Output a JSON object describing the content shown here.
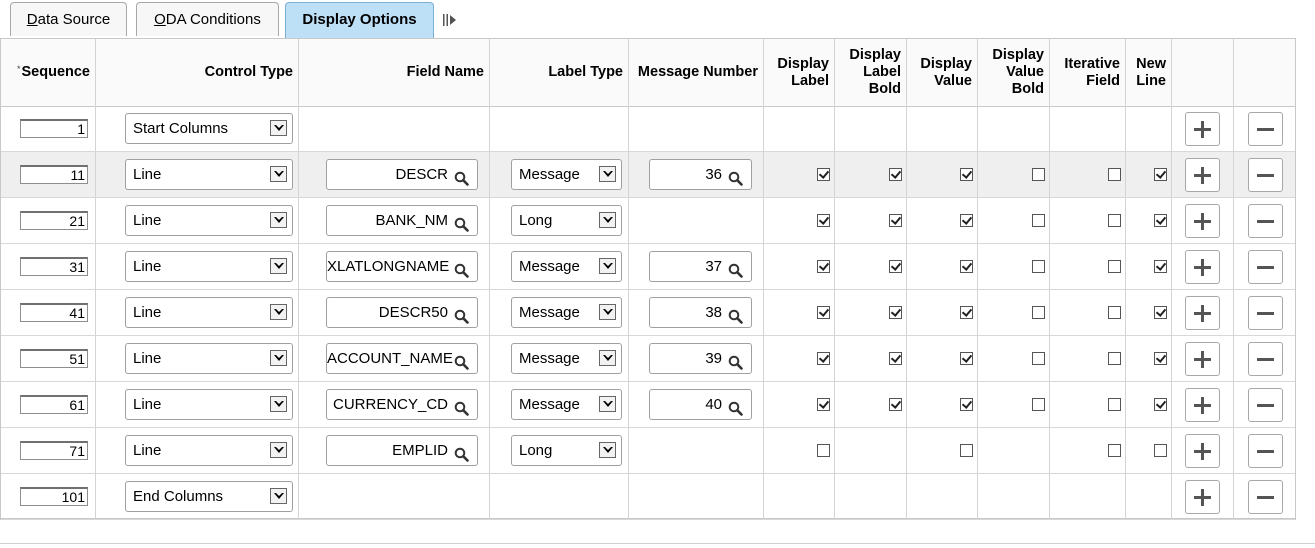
{
  "tabs": [
    {
      "label": "Data Source",
      "active": false
    },
    {
      "label": "ODA Conditions",
      "active": false
    },
    {
      "label": "Display Options",
      "active": true
    }
  ],
  "columns": {
    "sequence": "Sequence",
    "control_type": "Control Type",
    "field_name": "Field Name",
    "label_type": "Label Type",
    "message_number": "Message Number",
    "display_label": "Display Label",
    "display_label_bold": "Display Label Bold",
    "display_value": "Display Value",
    "display_value_bold": "Display Value Bold",
    "iterative_field": "Iterative Field",
    "new_line": "New Line"
  },
  "rows": [
    {
      "sequence": "1",
      "control_type": "Start Columns",
      "field_name": null,
      "label_type": null,
      "message_number": null,
      "display_label": null,
      "display_label_bold": null,
      "display_value": null,
      "display_value_bold": null,
      "iterative_field": null,
      "new_line": null
    },
    {
      "sequence": "11",
      "control_type": "Line",
      "field_name": "DESCR",
      "label_type": "Message",
      "message_number": "36",
      "display_label": true,
      "display_label_bold": true,
      "display_value": true,
      "display_value_bold": false,
      "iterative_field": false,
      "new_line": true
    },
    {
      "sequence": "21",
      "control_type": "Line",
      "field_name": "BANK_NM",
      "label_type": "Long",
      "message_number": null,
      "display_label": true,
      "display_label_bold": true,
      "display_value": true,
      "display_value_bold": false,
      "iterative_field": false,
      "new_line": true
    },
    {
      "sequence": "31",
      "control_type": "Line",
      "field_name": "XLATLONGNAME",
      "label_type": "Message",
      "message_number": "37",
      "display_label": true,
      "display_label_bold": true,
      "display_value": true,
      "display_value_bold": false,
      "iterative_field": false,
      "new_line": true
    },
    {
      "sequence": "41",
      "control_type": "Line",
      "field_name": "DESCR50",
      "label_type": "Message",
      "message_number": "38",
      "display_label": true,
      "display_label_bold": true,
      "display_value": true,
      "display_value_bold": false,
      "iterative_field": false,
      "new_line": true
    },
    {
      "sequence": "51",
      "control_type": "Line",
      "field_name": "ACCOUNT_NAME",
      "label_type": "Message",
      "message_number": "39",
      "display_label": true,
      "display_label_bold": true,
      "display_value": true,
      "display_value_bold": false,
      "iterative_field": false,
      "new_line": true
    },
    {
      "sequence": "61",
      "control_type": "Line",
      "field_name": "CURRENCY_CD",
      "label_type": "Message",
      "message_number": "40",
      "display_label": true,
      "display_label_bold": true,
      "display_value": true,
      "display_value_bold": false,
      "iterative_field": false,
      "new_line": true
    },
    {
      "sequence": "71",
      "control_type": "Line",
      "field_name": "EMPLID",
      "label_type": "Long",
      "message_number": null,
      "display_label": false,
      "display_label_bold": null,
      "display_value": false,
      "display_value_bold": null,
      "iterative_field": false,
      "new_line": false
    },
    {
      "sequence": "101",
      "control_type": "End Columns",
      "field_name": null,
      "label_type": null,
      "message_number": null,
      "display_label": null,
      "display_label_bold": null,
      "display_value": null,
      "display_value_bold": null,
      "iterative_field": null,
      "new_line": null
    }
  ],
  "icons": {
    "lookup": "magnifier-icon",
    "dropdown": "dropdown-arrow-icon",
    "add": "plus-icon",
    "delete": "minus-icon",
    "collapse": "collapse-tabs-icon"
  },
  "colors": {
    "active_tab": "#bde0f7",
    "alt_row": "#efefef"
  }
}
